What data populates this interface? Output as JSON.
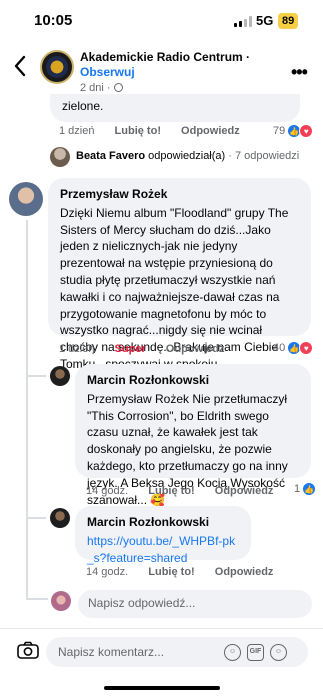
{
  "status": {
    "time": "10:05",
    "network": "5G",
    "battery": "89"
  },
  "header": {
    "page_name": "Akademickie Radio Centrum",
    "separator": " · ",
    "follow_label": "Obserwuj",
    "meta": "2 dni · ",
    "more": "•••"
  },
  "comment_top": {
    "text_tail": "zielone.",
    "time": "1 dzień",
    "like": "Lubię to!",
    "reply": "Odpowiedz",
    "reaction_count": "79"
  },
  "reply_summary": {
    "author": "Beata Favero",
    "action": " odpowiedział(a)",
    "count": " · 7 odpowiedzi"
  },
  "comment_przemyslaw": {
    "author": "Przemysław Rożek",
    "text": "Dzięki Niemu album \"Floodland\" grupy The Sisters of Mercy słucham do dziś...Jako jeden z nielicznych-jak nie jedyny prezentował na wstępie przyniesioną do studia płytę przetłumaczył wszystkie nań kawałki i co najważniejsze-dawał czas na przygotowanie magnetofonu by móc to wszystko nagrać...nigdy się nie wcinał choćby na sekundę...Brakuje nam Ciebie Tomku...spoczywaj w spokoju...",
    "time": "1 dzień",
    "like": "Super",
    "reply": "Odpowiedz",
    "reaction_count": "40"
  },
  "reply_marcin_1": {
    "author": "Marcin Rozłonkowski",
    "text": "Przemysław Rożek Nie przetłumaczył \"This Corrosion\", bo Eldrith swego czasu uznał, że kawałek jest tak doskonały po angielsku, że pozwie każdego, kto przetłumaczy go na inny język. A Beksa Jego Kocią Wysokość szanował... 🥰",
    "time": "14 godz.",
    "like": "Lubię to!",
    "reply": "Odpowiedz",
    "reaction_count": "1"
  },
  "reply_marcin_2": {
    "author": "Marcin Rozłonkowski",
    "link": "https://youtu.be/_WHPBf-pk_s?feature=shared",
    "time": "14 godz.",
    "like": "Lubię to!",
    "reply": "Odpowiedz"
  },
  "reply_input": {
    "placeholder": "Napisz odpowiedź..."
  },
  "bottom": {
    "placeholder": "Napisz komentarz...",
    "gif_label": "GIF"
  },
  "colors": {
    "accent": "#1877f2",
    "super": "#e41e3f",
    "bubble": "#f0f2f5"
  }
}
